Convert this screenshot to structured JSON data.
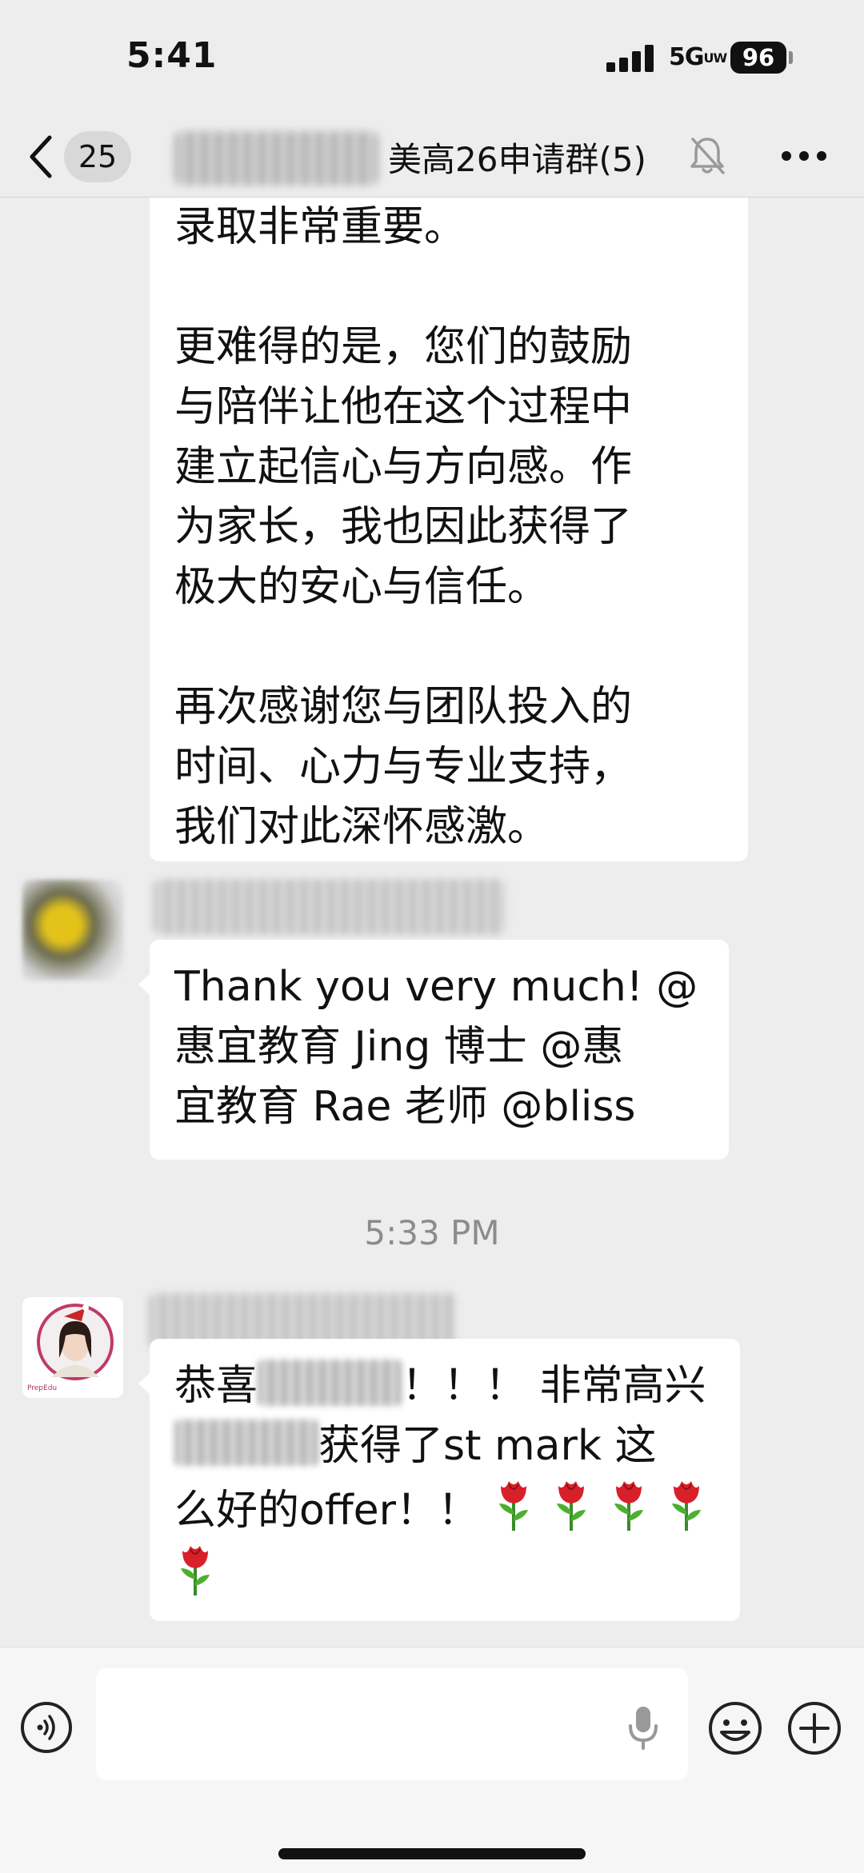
{
  "status_bar": {
    "time": "5:41",
    "network": "5G",
    "network_sub": "UW",
    "battery": "96"
  },
  "header": {
    "unread_count": "25",
    "title": "美高26申请群(5)",
    "icons": [
      "chevron-left-icon",
      "bell-muted-icon",
      "more-icon"
    ]
  },
  "messages": [
    {
      "type": "text",
      "paragraphs": [
        [
          "录取非常重要。"
        ],
        [
          "更难得的是，您们的鼓励",
          "与陪伴让他在这个过程中",
          "建立起信心与方向感。作",
          "为家长，我也因此获得了",
          "极大的安心与信任。"
        ],
        [
          "再次感谢您与团队投入的",
          "时间、心力与专业支持，",
          "我们对此深怀感激。"
        ]
      ]
    },
    {
      "type": "text",
      "lines": [
        "Thank you very much! @",
        "惠宜教育 Jing 博士 @惠",
        "宜教育 Rae 老师 @bliss"
      ]
    },
    {
      "type": "timestamp",
      "text": "5:33 PM"
    },
    {
      "type": "text",
      "line1_start": "恭喜",
      "line1_end": "！！！ 非常高兴",
      "line2_end": "获得了st mark 这",
      "line3": "么好的offer！！",
      "rose_count": 5,
      "emoji_name": "rose-emoji"
    }
  ],
  "input_bar": {
    "placeholder": "",
    "icons": [
      "voice-icon",
      "microphone-icon",
      "emoji-icon",
      "plus-icon"
    ]
  },
  "colors": {
    "background": "#ededed",
    "bubble": "#ffffff",
    "timestamp": "#8c8c8c",
    "rose": "#d8202a"
  }
}
